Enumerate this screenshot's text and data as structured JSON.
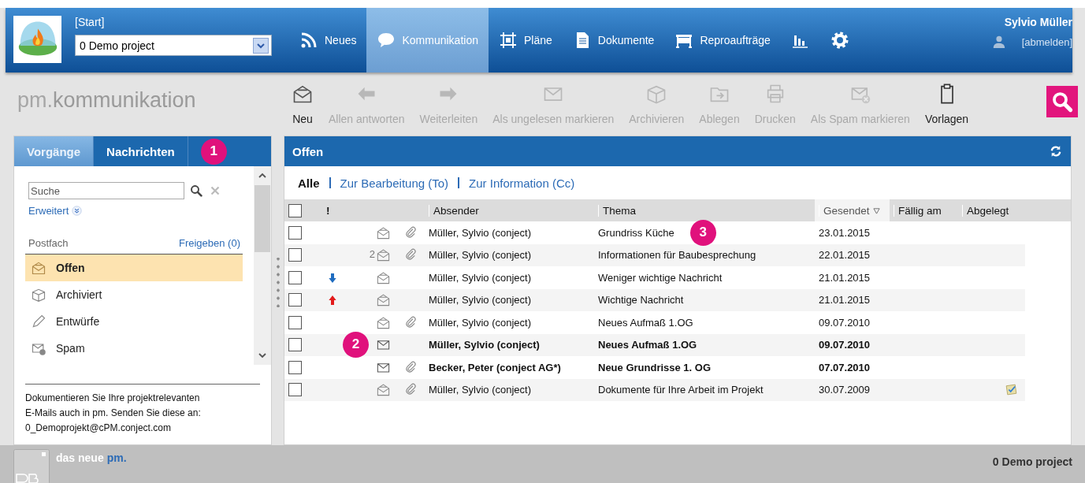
{
  "header": {
    "breadcrumb": "[Start]",
    "project_select": {
      "value": "0 Demo project"
    },
    "nav": [
      {
        "label": "Neues",
        "kind": "rss",
        "selected": false
      },
      {
        "label": "Kommunikation",
        "kind": "chat",
        "selected": true
      },
      {
        "label": "Pläne",
        "kind": "plan",
        "selected": false
      },
      {
        "label": "Dokumente",
        "kind": "doc",
        "selected": false
      },
      {
        "label": "Reproaufträge",
        "kind": "plotter",
        "selected": false
      },
      {
        "kind": "chart",
        "selected": false
      },
      {
        "kind": "gear",
        "selected": false
      }
    ],
    "user": {
      "name": "Sylvio Müller",
      "logout": "[abmelden]"
    }
  },
  "toolbar": {
    "app_prefix": "pm.",
    "app_name": "kommunikation",
    "actions": [
      {
        "label": "Neu",
        "kind": "mail-open",
        "disabled": false
      },
      {
        "label": "Allen antworten",
        "kind": "arrow-left",
        "disabled": true
      },
      {
        "label": "Weiterleiten",
        "kind": "arrow-right",
        "disabled": true
      },
      {
        "label": "Als ungelesen markieren",
        "kind": "mail",
        "disabled": true
      },
      {
        "label": "Archivieren",
        "kind": "box",
        "disabled": true
      },
      {
        "label": "Ablegen",
        "kind": "folder",
        "disabled": true
      },
      {
        "label": "Drucken",
        "kind": "printer",
        "disabled": true
      },
      {
        "label": "Als Spam markieren",
        "kind": "mail-x",
        "disabled": true
      },
      {
        "label": "Vorlagen",
        "kind": "clipboard",
        "disabled": false
      }
    ]
  },
  "sidebar": {
    "tabs": [
      {
        "label": "Vorgänge",
        "selected": true
      },
      {
        "label": "Nachrichten",
        "selected": false
      }
    ],
    "callout": "1",
    "search": {
      "placeholder": "Suche"
    },
    "advanced": "Erweitert",
    "mailbox_label": "Postfach",
    "share_link": "Freigeben (0)",
    "folders": [
      {
        "label": "Offen",
        "kind": "mail-open",
        "selected": true
      },
      {
        "label": "Archiviert",
        "kind": "box",
        "selected": false
      },
      {
        "label": "Entwürfe",
        "kind": "pencil",
        "selected": false
      },
      {
        "label": "Spam",
        "kind": "mail-x",
        "selected": false
      }
    ],
    "info_lines": [
      "Dokumentieren Sie Ihre projektrelevanten",
      "E-Mails auch in pm. Senden Sie diese an:",
      "0_Demoprojekt@cPM.conject.com"
    ]
  },
  "main": {
    "title": "Offen",
    "filters": [
      {
        "label": "Alle",
        "selected": true
      },
      {
        "label": "Zur Bearbeitung (To)",
        "selected": false
      },
      {
        "label": "Zur Information (Cc)",
        "selected": false
      }
    ],
    "all_checked": false,
    "columns": [
      {
        "kind": "check"
      },
      {
        "kind": "priority",
        "label": "!"
      },
      {
        "kind": "icon"
      },
      {
        "kind": "attachment"
      },
      {
        "kind": "text",
        "label": "Absender",
        "sorted": false
      },
      {
        "kind": "text",
        "label": "Thema",
        "sorted": false
      },
      {
        "kind": "text",
        "label": "Gesendet",
        "sorted": true
      },
      {
        "kind": "text",
        "label": "Fällig am",
        "sorted": false
      },
      {
        "kind": "text",
        "label": "Abgelegt",
        "sorted": false
      }
    ],
    "rows": [
      {
        "checked": false,
        "high_priority": false,
        "low_priority": false,
        "unread": false,
        "attachment": true,
        "sender": "Müller, Sylvio (conject)",
        "subject": "Grundriss Küche",
        "sent": "23.01.2015",
        "filed": false,
        "subject_callout": "3"
      },
      {
        "checked": false,
        "high_priority": false,
        "low_priority": false,
        "count": "2",
        "unread": false,
        "attachment": true,
        "sender": "Müller, Sylvio (conject)",
        "subject": "Informationen für Baubesprechung",
        "sent": "22.01.2015",
        "filed": false
      },
      {
        "checked": false,
        "high_priority": false,
        "low_priority": true,
        "unread": false,
        "attachment": false,
        "sender": "Müller, Sylvio (conject)",
        "subject": "Weniger wichtige Nachricht",
        "sent": "21.01.2015",
        "filed": false
      },
      {
        "checked": false,
        "high_priority": true,
        "low_priority": false,
        "unread": false,
        "attachment": false,
        "sender": "Müller, Sylvio (conject)",
        "subject": "Wichtige Nachricht",
        "sent": "21.01.2015",
        "filed": false
      },
      {
        "checked": false,
        "high_priority": false,
        "low_priority": false,
        "unread": false,
        "attachment": true,
        "sender": "Müller, Sylvio (conject)",
        "subject": "Neues Aufmaß 1.OG",
        "sent": "09.07.2010",
        "filed": false
      },
      {
        "checked": false,
        "high_priority": false,
        "low_priority": false,
        "unread": true,
        "attachment": false,
        "sender": "Müller, Sylvio (conject)",
        "subject": "Neues Aufmaß 1.OG",
        "sent": "09.07.2010",
        "filed": false,
        "icon_callout": "2"
      },
      {
        "checked": false,
        "high_priority": false,
        "low_priority": false,
        "unread": true,
        "attachment": true,
        "sender": "Becker, Peter (conject AG*)",
        "subject": "Neue Grundrisse 1. OG",
        "sent": "07.07.2010",
        "filed": false
      },
      {
        "checked": false,
        "high_priority": false,
        "low_priority": false,
        "unread": false,
        "attachment": true,
        "sender": "Müller, Sylvio (conject)",
        "subject": "Dokumente für Ihre Arbeit im Projekt",
        "sent": "30.07.2009",
        "filed": true
      }
    ]
  },
  "footer": {
    "slogan_prefix": "das neue",
    "slogan_brand": "pm.",
    "project": "0 Demo project"
  }
}
